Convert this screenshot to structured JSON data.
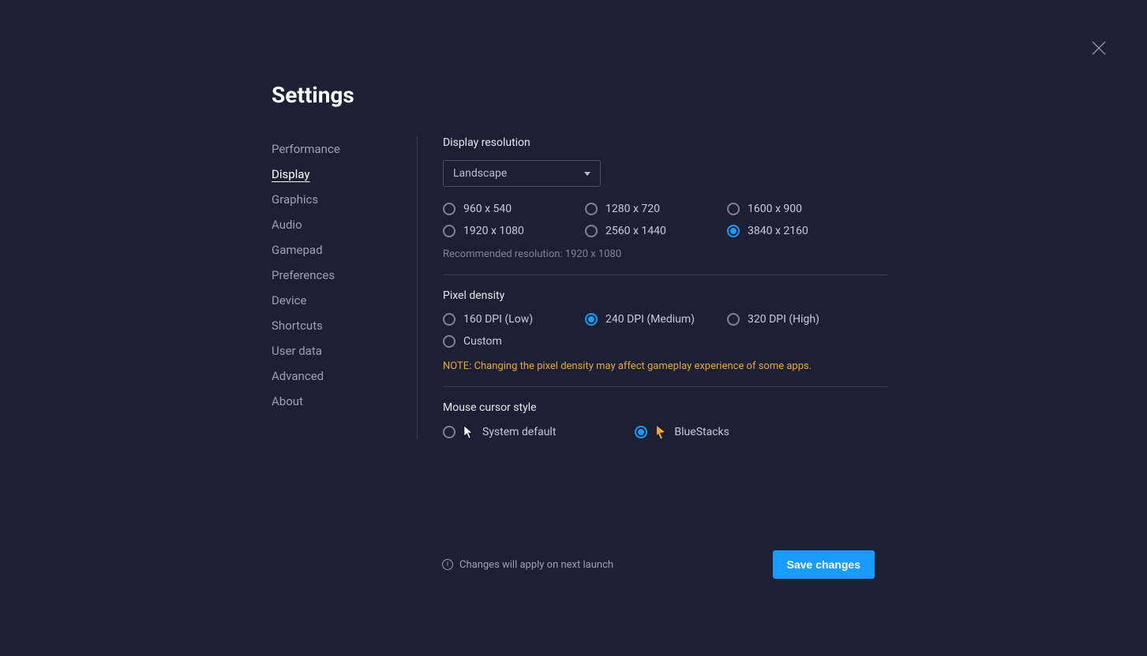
{
  "title": "Settings",
  "sidebar": {
    "items": [
      {
        "label": "Performance",
        "active": false
      },
      {
        "label": "Display",
        "active": true
      },
      {
        "label": "Graphics",
        "active": false
      },
      {
        "label": "Audio",
        "active": false
      },
      {
        "label": "Gamepad",
        "active": false
      },
      {
        "label": "Preferences",
        "active": false
      },
      {
        "label": "Device",
        "active": false
      },
      {
        "label": "Shortcuts",
        "active": false
      },
      {
        "label": "User data",
        "active": false
      },
      {
        "label": "Advanced",
        "active": false
      },
      {
        "label": "About",
        "active": false
      }
    ]
  },
  "display_resolution": {
    "label": "Display resolution",
    "orientation_selected": "Landscape",
    "options": [
      {
        "label": "960 x 540",
        "selected": false
      },
      {
        "label": "1280 x 720",
        "selected": false
      },
      {
        "label": "1600 x 900",
        "selected": false
      },
      {
        "label": "1920 x 1080",
        "selected": false
      },
      {
        "label": "2560 x 1440",
        "selected": false
      },
      {
        "label": "3840 x 2160",
        "selected": true
      }
    ],
    "recommended": "Recommended resolution: 1920 x 1080"
  },
  "pixel_density": {
    "label": "Pixel density",
    "options": [
      {
        "label": "160 DPI (Low)",
        "selected": false
      },
      {
        "label": "240 DPI (Medium)",
        "selected": true
      },
      {
        "label": "320 DPI (High)",
        "selected": false
      },
      {
        "label": "Custom",
        "selected": false
      }
    ],
    "note": "NOTE: Changing the pixel density may affect gameplay experience of some apps."
  },
  "cursor_style": {
    "label": "Mouse cursor style",
    "options": [
      {
        "label": "System default",
        "selected": false
      },
      {
        "label": "BlueStacks",
        "selected": true
      }
    ]
  },
  "footer": {
    "info": "Changes will apply on next launch",
    "save_label": "Save changes"
  }
}
